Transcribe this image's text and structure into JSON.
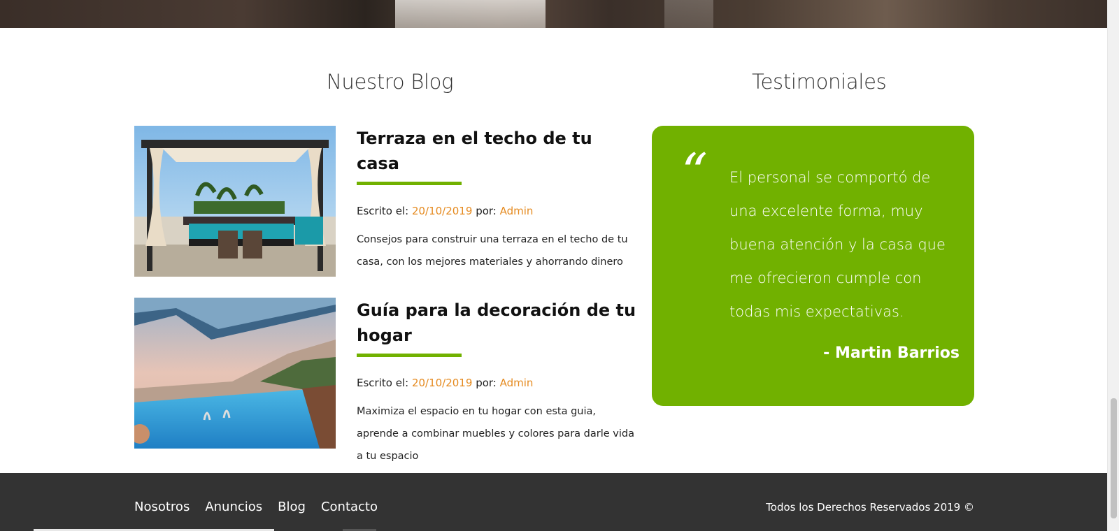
{
  "sections": {
    "blog_title": "Nuestro Blog",
    "testimonials_title": "Testimoniales"
  },
  "posts": [
    {
      "title": "Terraza en el techo de tu casa",
      "written_label": "Escrito el:",
      "date": "20/10/2019",
      "by_label": "por:",
      "author": "Admin",
      "excerpt": "Consejos para construir una terraza en el techo de tu casa, con los mejores materiales y ahorrando dinero"
    },
    {
      "title": "Guía para la decoración de tu hogar",
      "written_label": "Escrito el:",
      "date": "20/10/2019",
      "by_label": "por:",
      "author": "Admin",
      "excerpt": "Maximiza el espacio en tu hogar con esta guia, aprende a combinar muebles y colores para darle vida a tu espacio"
    }
  ],
  "testimonial": {
    "quote_mark": "“",
    "text": "El personal se comportó de una excelente forma, muy buena atención y la casa que me ofrecieron cumple con todas mis expectativas.",
    "author": "- Martin Barrios"
  },
  "footer": {
    "nav": [
      "Nosotros",
      "Anuncios",
      "Blog",
      "Contacto"
    ],
    "copyright": "Todos los Derechos Reservados 2019 ©"
  },
  "colors": {
    "accent_green": "#71b100",
    "accent_orange": "#e58a1f",
    "footer_bg": "#333333"
  }
}
